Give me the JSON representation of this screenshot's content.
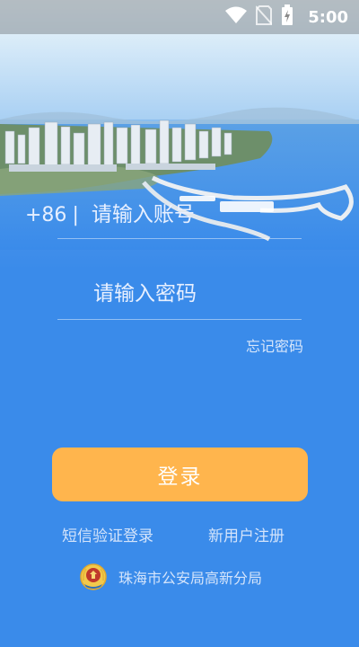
{
  "status_bar": {
    "time": "5:00",
    "icons": [
      "wifi-icon",
      "no-sim-icon",
      "battery-charging-icon"
    ]
  },
  "banner": {
    "image": "city-coastline-banner"
  },
  "login_form": {
    "country_code": "+86",
    "separator": "|",
    "account_placeholder": "请输入账号",
    "password_placeholder": "请输入密码",
    "forgot_password": "忘记密码",
    "login_button": "登录",
    "sms_login": "短信验证登录",
    "register": "新用户注册"
  },
  "footer": {
    "emblem": "police-emblem-icon",
    "organization": "珠海市公安局高新分局"
  },
  "colors": {
    "background": "#3a8bea",
    "button": "#ffb54d",
    "link_text": "#d4e4fb"
  }
}
